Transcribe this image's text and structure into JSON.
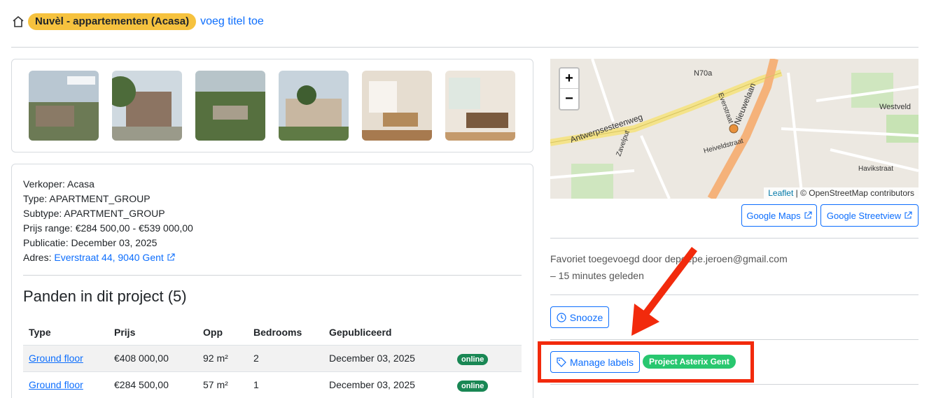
{
  "header": {
    "badge": "Nuvèl - appartementen (Acasa)",
    "add_title": "voeg titel toe"
  },
  "info": {
    "seller": "Verkoper: Acasa",
    "type": "Type: APARTMENT_GROUP",
    "subtype": "Subtype: APARTMENT_GROUP",
    "price_range": "Prijs range: €284 500,00 - €539 000,00",
    "publication": "Publicatie: December 03, 2025",
    "address_label": "Adres: ",
    "address_link": "Everstraat 44, 9040 Gent"
  },
  "section_title": "Panden in dit project (5)",
  "table": {
    "headers": [
      "Type",
      "Prijs",
      "Opp",
      "Bedrooms",
      "Gepubliceerd",
      ""
    ],
    "rows": [
      {
        "type": "Ground floor",
        "price": "€408 000,00",
        "area": "92 m²",
        "bedrooms": "2",
        "published": "December 03, 2025",
        "status": "online"
      },
      {
        "type": "Ground floor",
        "price": "€284 500,00",
        "area": "57 m²",
        "bedrooms": "1",
        "published": "December 03, 2025",
        "status": "online"
      }
    ]
  },
  "map": {
    "zoom_in": "+",
    "zoom_out": "−",
    "attribution_link": "Leaflet",
    "attribution_text": " | © OpenStreetMap contributors",
    "streets": [
      "N70a",
      "Antwerpsesteenweg",
      "Nieuwelaan",
      "Heiveldstraat",
      "Westveld",
      "Everstraat",
      "Zavelput",
      "Havikstraat"
    ]
  },
  "buttons": {
    "google_maps": "Google Maps",
    "google_streetview": "Google Streetview",
    "snooze": "Snooze",
    "manage_labels": "Manage labels"
  },
  "favorite": {
    "line1": "Favoriet toegevoegd door depoepe.jeroen@gmail.com",
    "line2": "– 15 minutes geleden"
  },
  "label": {
    "name": "Project Asterix Gent"
  },
  "colors": {
    "accent": "#0d6efd",
    "badge": "#f6c23e",
    "online": "#198754",
    "label": "#28c76f",
    "highlight": "#f22a0c"
  }
}
